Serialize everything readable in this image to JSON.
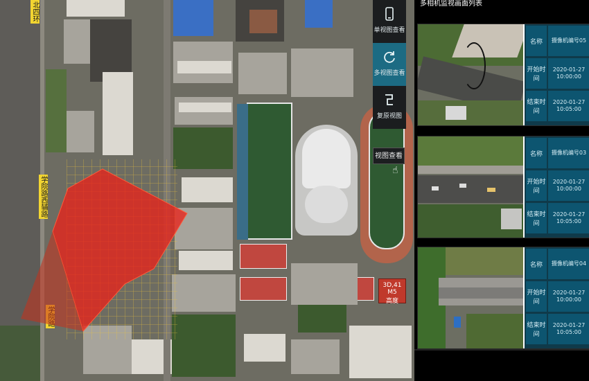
{
  "map": {
    "road_labels": [
      {
        "text": "北四环"
      },
      {
        "text": "学院路西辅路"
      },
      {
        "text": "学院路"
      }
    ],
    "map_tag": "3D,41 M5\n高度"
  },
  "toolbar": {
    "items": [
      {
        "label": "单视图查看",
        "icon": "phone-icon"
      },
      {
        "label": "多视图查看",
        "icon": "refresh-icon"
      },
      {
        "label": "复原视图",
        "icon": "layers-icon"
      }
    ],
    "tooltip": "视图查看"
  },
  "panel": {
    "title": "多相机监视画面列表",
    "cards": [
      {
        "rows": [
          {
            "k": "名称",
            "v": "摄像机编号05"
          },
          {
            "k": "开始时间",
            "v": "2020-01-27\n10:00:00"
          },
          {
            "k": "结束时间",
            "v": "2020-01-27\n10:05:00"
          }
        ]
      },
      {
        "rows": [
          {
            "k": "名称",
            "v": "摄像机编号03"
          },
          {
            "k": "开始时间",
            "v": "2020-01-27\n10:00:00"
          },
          {
            "k": "结束时间",
            "v": "2020-01-27\n10:05:00"
          }
        ]
      },
      {
        "rows": [
          {
            "k": "名称",
            "v": "摄像机编号04"
          },
          {
            "k": "开始时间",
            "v": "2020-01-27\n10:00:00"
          },
          {
            "k": "结束时间",
            "v": "2020-01-27\n10:05:00"
          }
        ]
      }
    ]
  },
  "colors": {
    "accent": "#1c6b83",
    "meta_cell": "#0d5570",
    "coverage": "#e8231b"
  }
}
